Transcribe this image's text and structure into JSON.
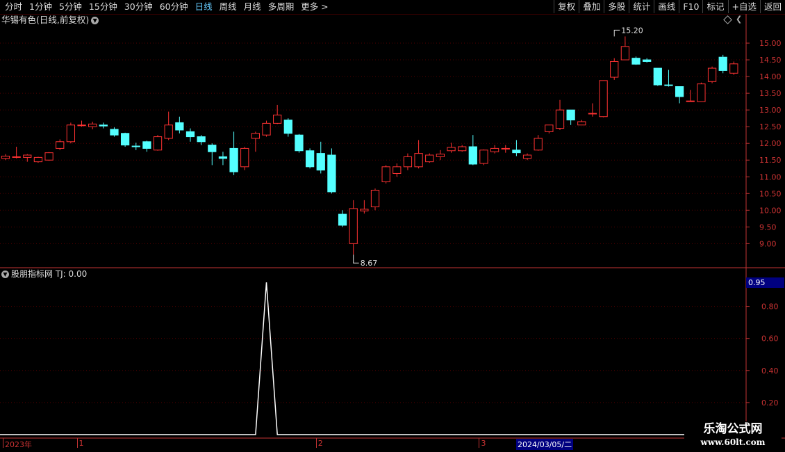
{
  "toolbar": {
    "periods": [
      "分时",
      "1分钟",
      "5分钟",
      "15分钟",
      "30分钟",
      "60分钟",
      "日线",
      "周线",
      "月线",
      "多周期",
      "更多 >"
    ],
    "active_period": "日线",
    "actions": [
      "复权",
      "叠加",
      "多股",
      "统计",
      "画线",
      "F10",
      "标记",
      "+自选",
      "返回"
    ]
  },
  "main_title": "华锡有色(日线,前复权)",
  "indicator_title": "股朋指标网  TJ: 0.00",
  "indicator_current": "0.95",
  "colors": {
    "up": "#ff3232",
    "down": "#54ffff",
    "axis": "#c33333",
    "grid": "#550000",
    "indicator_line": "#ffffff"
  },
  "chart_data": [
    {
      "type": "candlestick",
      "title": "华锡有色(日线,前复权)",
      "ylim": [
        8.3,
        15.5
      ],
      "yticks": [
        "15.00",
        "14.50",
        "14.00",
        "13.50",
        "13.00",
        "12.50",
        "12.00",
        "11.50",
        "11.00",
        "10.50",
        "10.00",
        "9.50",
        "9.00"
      ],
      "annotations": [
        {
          "label": "15.20",
          "value": 15.2,
          "index": 56
        },
        {
          "label": "8.67",
          "value": 8.67,
          "index": 32
        }
      ],
      "ohlc": [
        [
          11.55,
          11.62,
          11.5,
          11.68
        ],
        [
          11.6,
          11.6,
          11.55,
          11.9
        ],
        [
          11.58,
          11.65,
          11.45,
          11.68
        ],
        [
          11.45,
          11.58,
          11.42,
          11.6
        ],
        [
          11.5,
          11.72,
          11.48,
          11.74
        ],
        [
          11.85,
          12.05,
          11.8,
          12.12
        ],
        [
          12.05,
          12.55,
          12.0,
          12.62
        ],
        [
          12.55,
          12.55,
          12.5,
          12.68
        ],
        [
          12.5,
          12.58,
          12.42,
          12.65
        ],
        [
          12.55,
          12.52,
          12.45,
          12.62
        ],
        [
          12.42,
          12.25,
          12.2,
          12.48
        ],
        [
          12.3,
          11.95,
          11.9,
          12.32
        ],
        [
          11.92,
          11.9,
          11.8,
          12.02
        ],
        [
          12.05,
          11.85,
          11.75,
          12.08
        ],
        [
          11.8,
          12.2,
          11.78,
          12.25
        ],
        [
          12.15,
          12.55,
          12.1,
          12.95
        ],
        [
          12.62,
          12.4,
          12.3,
          12.8
        ],
        [
          12.35,
          12.2,
          12.05,
          12.45
        ],
        [
          12.2,
          12.05,
          11.95,
          12.25
        ],
        [
          11.95,
          11.75,
          11.35,
          12.0
        ],
        [
          11.6,
          11.55,
          11.35,
          11.75
        ],
        [
          11.85,
          11.15,
          11.05,
          12.35
        ],
        [
          11.3,
          11.85,
          11.2,
          11.9
        ],
        [
          12.15,
          12.3,
          11.75,
          12.35
        ],
        [
          12.25,
          12.6,
          12.2,
          12.68
        ],
        [
          12.6,
          12.85,
          12.58,
          13.15
        ],
        [
          12.7,
          12.3,
          12.2,
          12.75
        ],
        [
          12.25,
          11.78,
          11.72,
          12.28
        ],
        [
          11.78,
          11.3,
          11.25,
          11.85
        ],
        [
          11.7,
          11.2,
          11.1,
          12.05
        ],
        [
          11.65,
          10.55,
          10.5,
          11.85
        ],
        [
          9.88,
          9.55,
          9.5,
          10.0
        ],
        [
          9.0,
          10.05,
          8.67,
          10.3
        ],
        [
          9.98,
          10.03,
          9.9,
          10.3
        ],
        [
          10.1,
          10.6,
          10.0,
          10.65
        ],
        [
          10.85,
          11.3,
          10.8,
          11.35
        ],
        [
          11.1,
          11.3,
          11.0,
          11.4
        ],
        [
          11.3,
          11.6,
          11.2,
          11.7
        ],
        [
          11.3,
          11.7,
          11.25,
          12.1
        ],
        [
          11.45,
          11.65,
          11.42,
          11.7
        ],
        [
          11.6,
          11.68,
          11.5,
          11.8
        ],
        [
          11.78,
          11.88,
          11.72,
          12.02
        ],
        [
          11.78,
          11.9,
          11.75,
          11.95
        ],
        [
          11.9,
          11.38,
          11.35,
          12.25
        ],
        [
          11.4,
          11.8,
          11.35,
          11.82
        ],
        [
          11.75,
          11.85,
          11.7,
          11.95
        ],
        [
          11.85,
          11.85,
          11.72,
          11.95
        ],
        [
          11.8,
          11.72,
          11.62,
          12.1
        ],
        [
          11.55,
          11.65,
          11.5,
          11.7
        ],
        [
          11.8,
          12.15,
          11.78,
          12.25
        ],
        [
          12.35,
          12.55,
          12.3,
          12.55
        ],
        [
          12.45,
          13.0,
          12.4,
          13.3
        ],
        [
          13.0,
          12.7,
          12.55,
          13.0
        ],
        [
          12.55,
          12.65,
          12.55,
          12.7
        ],
        [
          12.88,
          12.9,
          12.8,
          13.2
        ],
        [
          12.8,
          13.88,
          12.78,
          13.88
        ],
        [
          13.98,
          14.45,
          13.9,
          14.55
        ],
        [
          14.5,
          14.9,
          14.5,
          15.2
        ],
        [
          14.55,
          14.37,
          14.35,
          14.6
        ],
        [
          14.5,
          14.45,
          14.42,
          14.55
        ],
        [
          14.25,
          13.75,
          13.72,
          14.25
        ],
        [
          13.75,
          13.73,
          13.7,
          14.2
        ],
        [
          13.7,
          13.4,
          13.2,
          13.7
        ],
        [
          13.27,
          13.27,
          13.25,
          13.6
        ],
        [
          13.25,
          13.78,
          13.25,
          13.82
        ],
        [
          13.85,
          14.25,
          13.8,
          14.3
        ],
        [
          14.58,
          14.18,
          14.1,
          14.65
        ],
        [
          14.1,
          14.38,
          14.05,
          14.45
        ]
      ]
    },
    {
      "type": "line",
      "title": "股朋指标网",
      "ylim": [
        0,
        0.95
      ],
      "yticks": [
        "0.80",
        "0.60",
        "0.40",
        "0.20"
      ],
      "x_count": 68,
      "spike_index": 24,
      "spike_value": 0.95,
      "baseline": 0
    }
  ],
  "date_axis": {
    "labels": [
      "2023年",
      "1",
      "2",
      "3"
    ],
    "label_index": [
      0,
      7,
      29,
      44
    ],
    "cursor_date": "2024/03/05/二"
  },
  "watermark": {
    "line1": "乐淘公式网",
    "line2": "www.60lt.com"
  }
}
